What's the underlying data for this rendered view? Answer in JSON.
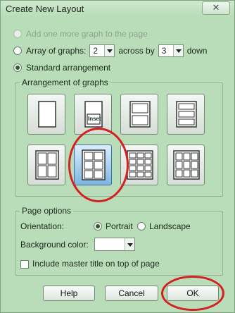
{
  "window": {
    "title": "Create New Layout",
    "close_glyph": "✕"
  },
  "options": {
    "add_one_more": "Add one more graph to the page",
    "array_of_graphs": "Array of graphs:",
    "array_rows": "2",
    "across_by": "across by",
    "array_cols": "3",
    "down": "down",
    "standard_arrangement": "Standard arrangement",
    "selected_option": "Standard arrangement"
  },
  "arrangement": {
    "legend": "Arrangement of graphs",
    "tiles": [
      {
        "id": "single"
      },
      {
        "id": "inset",
        "label": "Inset"
      },
      {
        "id": "two-rows"
      },
      {
        "id": "three-rows"
      },
      {
        "id": "2x2"
      },
      {
        "id": "2x3",
        "selected": true
      },
      {
        "id": "3x4"
      },
      {
        "id": "3x3"
      }
    ]
  },
  "page_options": {
    "legend": "Page options",
    "orientation_label": "Orientation:",
    "portrait": "Portrait",
    "landscape": "Landscape",
    "selected_orientation": "Portrait",
    "background_color_label": "Background color:",
    "background_color": "#ffffff",
    "include_master_title": "Include master title on top of page",
    "include_master_title_checked": false
  },
  "buttons": {
    "help": "Help",
    "cancel": "Cancel",
    "ok": "OK"
  },
  "colors": {
    "dialog_bg": "#b9ddb9",
    "highlight_circle": "#d42020",
    "selected_tile": "#7fb5e2"
  }
}
